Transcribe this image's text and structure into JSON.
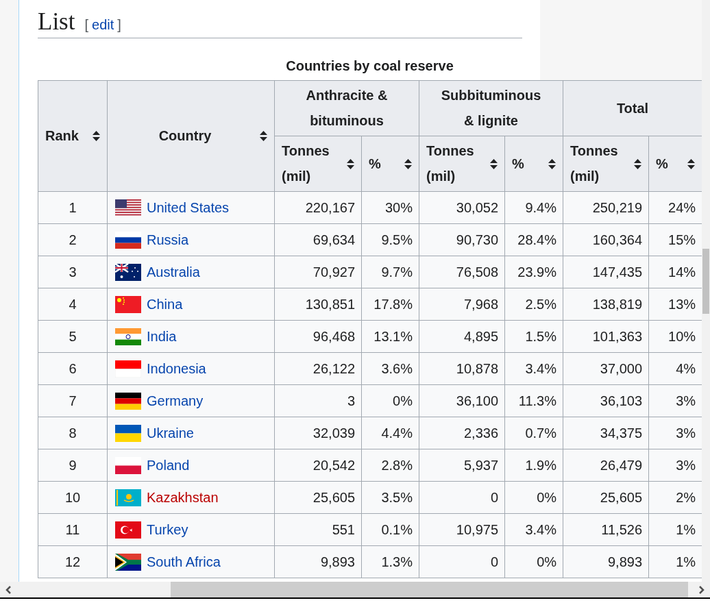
{
  "section": {
    "heading": "List",
    "edit_open": "[",
    "edit_link": "edit",
    "edit_close": "]"
  },
  "table": {
    "caption": "Countries by coal reserve",
    "header_top": [
      {
        "label": "Rank",
        "kind": "sortable"
      },
      {
        "label": "Country",
        "kind": "sortable"
      },
      {
        "label": "Anthracite & bituminous",
        "kind": "group"
      },
      {
        "label": "Subbituminous & lignite",
        "kind": "group"
      },
      {
        "label": "Total",
        "kind": "group"
      }
    ],
    "header_sub": [
      {
        "label": "Tonnes (mil)"
      },
      {
        "label": "%"
      },
      {
        "label": "Tonnes (mil)"
      },
      {
        "label": "%"
      },
      {
        "label": "Tonnes (mil)"
      },
      {
        "label": "%"
      }
    ],
    "rows": [
      {
        "rank": "1",
        "country": "United States",
        "redlink": false,
        "values": [
          "220,167",
          "30%",
          "30,052",
          "9.4%",
          "250,219",
          "24%"
        ]
      },
      {
        "rank": "2",
        "country": "Russia",
        "redlink": false,
        "values": [
          "69,634",
          "9.5%",
          "90,730",
          "28.4%",
          "160,364",
          "15%"
        ]
      },
      {
        "rank": "3",
        "country": "Australia",
        "redlink": false,
        "values": [
          "70,927",
          "9.7%",
          "76,508",
          "23.9%",
          "147,435",
          "14%"
        ]
      },
      {
        "rank": "4",
        "country": "China",
        "redlink": false,
        "values": [
          "130,851",
          "17.8%",
          "7,968",
          "2.5%",
          "138,819",
          "13%"
        ]
      },
      {
        "rank": "5",
        "country": "India",
        "redlink": false,
        "values": [
          "96,468",
          "13.1%",
          "4,895",
          "1.5%",
          "101,363",
          "10%"
        ]
      },
      {
        "rank": "6",
        "country": "Indonesia",
        "redlink": false,
        "values": [
          "26,122",
          "3.6%",
          "10,878",
          "3.4%",
          "37,000",
          "4%"
        ]
      },
      {
        "rank": "7",
        "country": "Germany",
        "redlink": false,
        "values": [
          "3",
          "0%",
          "36,100",
          "11.3%",
          "36,103",
          "3%"
        ]
      },
      {
        "rank": "8",
        "country": "Ukraine",
        "redlink": false,
        "values": [
          "32,039",
          "4.4%",
          "2,336",
          "0.7%",
          "34,375",
          "3%"
        ]
      },
      {
        "rank": "9",
        "country": "Poland",
        "redlink": false,
        "values": [
          "20,542",
          "2.8%",
          "5,937",
          "1.9%",
          "26,479",
          "3%"
        ]
      },
      {
        "rank": "10",
        "country": "Kazakhstan",
        "redlink": true,
        "values": [
          "25,605",
          "3.5%",
          "0",
          "0%",
          "25,605",
          "2%"
        ]
      },
      {
        "rank": "11",
        "country": "Turkey",
        "redlink": false,
        "values": [
          "551",
          "0.1%",
          "10,975",
          "3.4%",
          "11,526",
          "1%"
        ]
      },
      {
        "rank": "12",
        "country": "South Africa",
        "redlink": false,
        "values": [
          "9,893",
          "1.3%",
          "0",
          "0%",
          "9,893",
          "1%"
        ]
      }
    ]
  }
}
